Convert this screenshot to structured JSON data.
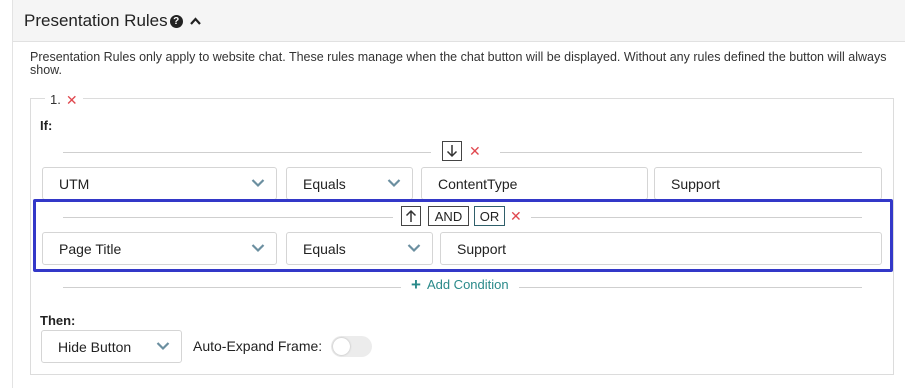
{
  "header": {
    "title": "Presentation Rules"
  },
  "description": "Presentation Rules only apply to website chat. These rules manage when the chat button will be displayed. Without any rules defined the button will always show.",
  "rule": {
    "number": "1.",
    "if_label": "If:",
    "conditions": [
      {
        "field": "UTM",
        "operator": "Equals",
        "key": "ContentType",
        "value": "Support"
      },
      {
        "field": "Page Title",
        "operator": "Equals",
        "value": "Support",
        "connector_and": "AND",
        "connector_or": "OR",
        "selected_connector": "OR"
      }
    ],
    "add_condition": "Add Condition",
    "then_label": "Then:",
    "action": "Hide Button",
    "auto_expand_label": "Auto-Expand Frame:",
    "auto_expand_on": false
  },
  "colors": {
    "delete": "#e0484f",
    "link": "#2a8a8a",
    "highlight": "#3338c8"
  }
}
